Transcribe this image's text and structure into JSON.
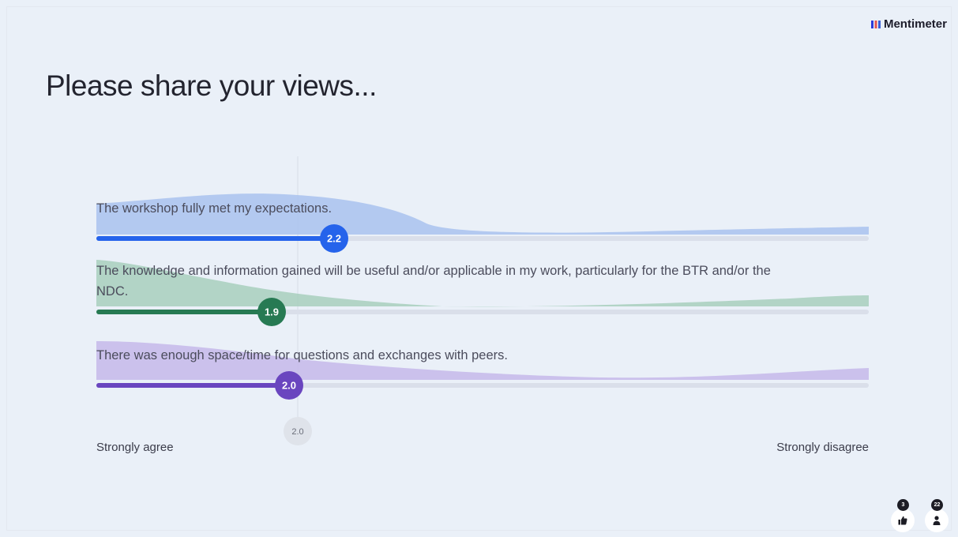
{
  "brand": {
    "name": "Mentimeter"
  },
  "title": "Please share your views...",
  "chart_data": {
    "type": "scale",
    "scale_min_label": "Strongly agree",
    "scale_max_label": "Strongly disagree",
    "overall_average": "2.0",
    "statements": [
      {
        "text": "The workshop fully met my expectations.",
        "average": 2.2,
        "average_label": "2.2",
        "color": "#2563eb",
        "fill": "#a9c2ee"
      },
      {
        "text": "The knowledge and information gained will be useful and/or applicable in my work, particularly for the BTR and/or the NDC.",
        "average": 1.9,
        "average_label": "1.9",
        "color": "#277a53",
        "fill": "#a8cfbd"
      },
      {
        "text": "There was enough space/time for questions and exchanges with peers.",
        "average": 2.0,
        "average_label": "2.0",
        "color": "#6a46bf",
        "fill": "#c6b8ea"
      }
    ]
  },
  "footer": {
    "reactions_count": "3",
    "participants_count": "22"
  }
}
